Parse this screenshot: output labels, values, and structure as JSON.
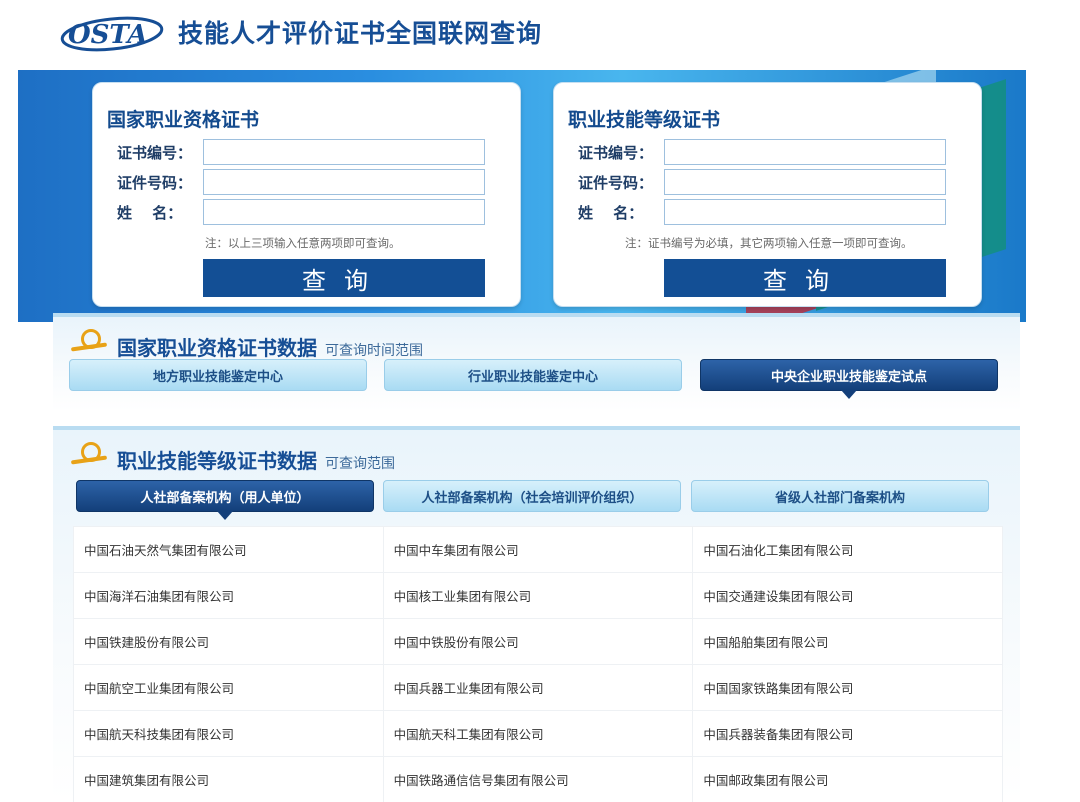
{
  "header": {
    "logo_text": "OSTA",
    "title": "技能人才评价证书全国联网查询"
  },
  "panels": {
    "national": {
      "title": "国家职业资格证书",
      "fields": [
        {
          "label": "证书编号：",
          "value": ""
        },
        {
          "label": "证件号码：",
          "value": ""
        },
        {
          "label": "姓　 名：",
          "value": ""
        }
      ],
      "note": "注：以上三项输入任意两项即可查询。",
      "button": "查询"
    },
    "skill": {
      "title": "职业技能等级证书",
      "fields": [
        {
          "label": "证书编号：",
          "value": ""
        },
        {
          "label": "证件号码：",
          "value": ""
        },
        {
          "label": "姓　 名：",
          "value": ""
        }
      ],
      "note": "注：证书编号为必填，其它两项输入任意一项即可查询。",
      "button": "查询"
    }
  },
  "section1": {
    "title": "国家职业资格证书数据",
    "subtitle": "可查询时间范围",
    "tabs": [
      "地方职业技能鉴定中心",
      "行业职业技能鉴定中心",
      "中央企业职业技能鉴定试点"
    ],
    "active_tab": 2
  },
  "section2": {
    "title": "职业技能等级证书数据",
    "subtitle": "可查询范围",
    "tabs": [
      "人社部备案机构（用人单位）",
      "人社部备案机构（社会培训评价组织）",
      "省级人社部门备案机构"
    ],
    "active_tab": 0,
    "orgs": [
      [
        "中国石油天然气集团有限公司",
        "中国中车集团有限公司",
        "中国石油化工集团有限公司"
      ],
      [
        "中国海洋石油集团有限公司",
        "中国核工业集团有限公司",
        "中国交通建设集团有限公司"
      ],
      [
        "中国铁建股份有限公司",
        "中国中铁股份有限公司",
        "中国船舶集团有限公司"
      ],
      [
        "中国航空工业集团有限公司",
        "中国兵器工业集团有限公司",
        "中国国家铁路集团有限公司"
      ],
      [
        "中国航天科技集团有限公司",
        "中国航天科工集团有限公司",
        "中国兵器装备集团有限公司"
      ],
      [
        "中国建筑集团有限公司",
        "中国铁路通信信号集团有限公司",
        "中国邮政集团有限公司"
      ]
    ]
  },
  "colors": {
    "brand": "#164e95",
    "button": "#134f95",
    "banner": "#2a8ee0"
  }
}
